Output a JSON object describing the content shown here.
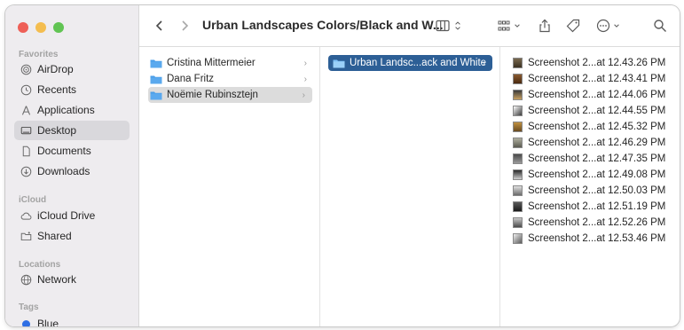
{
  "window": {
    "title": "Urban Landscapes Colors/Black and W..."
  },
  "sidebar": {
    "favorites_label": "Favorites",
    "favorites": [
      {
        "label": "AirDrop",
        "icon": "airdrop-icon"
      },
      {
        "label": "Recents",
        "icon": "clock-icon"
      },
      {
        "label": "Applications",
        "icon": "applications-icon"
      },
      {
        "label": "Desktop",
        "icon": "desktop-icon",
        "selected": true
      },
      {
        "label": "Documents",
        "icon": "document-icon"
      },
      {
        "label": "Downloads",
        "icon": "download-icon"
      }
    ],
    "icloud_label": "iCloud",
    "icloud": [
      {
        "label": "iCloud Drive",
        "icon": "cloud-icon"
      },
      {
        "label": "Shared",
        "icon": "shared-folder-icon"
      }
    ],
    "locations_label": "Locations",
    "locations": [
      {
        "label": "Network",
        "icon": "network-icon"
      }
    ],
    "tags_label": "Tags",
    "tags": [
      {
        "label": "Blue",
        "color": "#2f6fe4"
      }
    ]
  },
  "columns": {
    "col1": [
      {
        "label": "Cristina Mittermeier"
      },
      {
        "label": "Dana Fritz"
      },
      {
        "label": "Noëmie Rubinsztejn",
        "selected": true
      }
    ],
    "col2": [
      {
        "label": "Urban Landsc...ack and White",
        "selected": true
      }
    ],
    "col3": [
      {
        "label": "Screenshot 2...at 12.43.26 PM"
      },
      {
        "label": "Screenshot 2...at 12.43.41 PM"
      },
      {
        "label": "Screenshot 2...at 12.44.06 PM"
      },
      {
        "label": "Screenshot 2...at 12.44.55 PM"
      },
      {
        "label": "Screenshot 2...at 12.45.32 PM"
      },
      {
        "label": "Screenshot 2...at 12.46.29 PM"
      },
      {
        "label": "Screenshot 2...at 12.47.35 PM"
      },
      {
        "label": "Screenshot 2...at 12.49.08 PM"
      },
      {
        "label": "Screenshot 2...at 12.50.03 PM"
      },
      {
        "label": "Screenshot 2...at 12.51.19 PM"
      },
      {
        "label": "Screenshot 2...at 12.52.26 PM"
      },
      {
        "label": "Screenshot 2...at 12.53.46 PM"
      }
    ]
  },
  "colors": {
    "accent_selected": "#2d5f96",
    "folder": "#4a9ee8"
  }
}
